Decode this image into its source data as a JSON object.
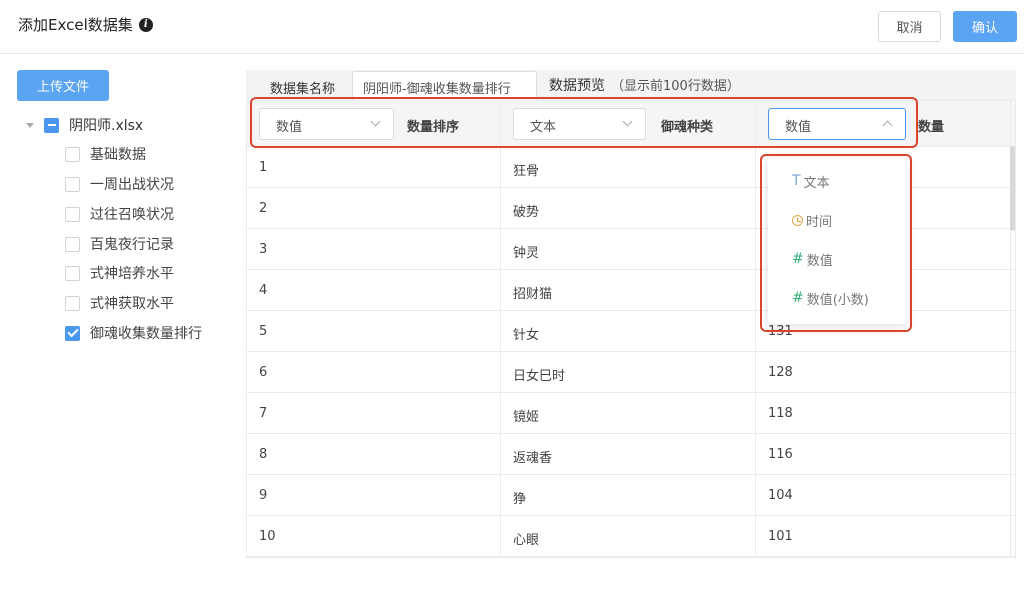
{
  "header": {
    "title": "添加Excel数据集",
    "info_icon": "info-icon",
    "cancel_label": "取消",
    "confirm_label": "确认"
  },
  "sidebar": {
    "upload_label": "上传文件",
    "file_name": "阴阳师.xlsx",
    "sheets": [
      {
        "label": "基础数据",
        "checked": false
      },
      {
        "label": "一周出战状况",
        "checked": false
      },
      {
        "label": "过往召唤状况",
        "checked": false
      },
      {
        "label": "百鬼夜行记录",
        "checked": false
      },
      {
        "label": "式神培养水平",
        "checked": false
      },
      {
        "label": "式神获取水平",
        "checked": false
      },
      {
        "label": "御魂收集数量排行",
        "checked": true
      }
    ]
  },
  "main": {
    "dataset_name_label": "数据集名称",
    "dataset_name_value": "阴阳师-御魂收集数量排行",
    "preview_label": "数据预览",
    "preview_note": "（显示前100行数据）"
  },
  "table": {
    "columns": [
      {
        "type": "数值",
        "name": "数量排序"
      },
      {
        "type": "文本",
        "name": "御魂种类"
      },
      {
        "type": "数值",
        "name": "数量"
      }
    ],
    "rows": [
      [
        "1",
        "狂骨",
        ""
      ],
      [
        "2",
        "破势",
        ""
      ],
      [
        "3",
        "钟灵",
        ""
      ],
      [
        "4",
        "招财猫",
        ""
      ],
      [
        "5",
        "针女",
        "131"
      ],
      [
        "6",
        "日女巳时",
        "128"
      ],
      [
        "7",
        "镜姬",
        "118"
      ],
      [
        "8",
        "返魂香",
        "116"
      ],
      [
        "9",
        "狰",
        "104"
      ],
      [
        "10",
        "心眼",
        "101"
      ]
    ]
  },
  "dropdown": {
    "options": [
      {
        "icon": "T",
        "label": "文本",
        "icon_color": "#7aa7d8"
      },
      {
        "icon": "clock",
        "label": "时间",
        "icon_color": "#e0a84a"
      },
      {
        "icon": "#",
        "label": "数值",
        "icon_color": "#3ab07c"
      },
      {
        "icon": "#",
        "label": "数值(小数)",
        "icon_color": "#3ab07c"
      }
    ]
  },
  "colors": {
    "primary": "#5aa4f3",
    "highlight": "#d9432f"
  }
}
